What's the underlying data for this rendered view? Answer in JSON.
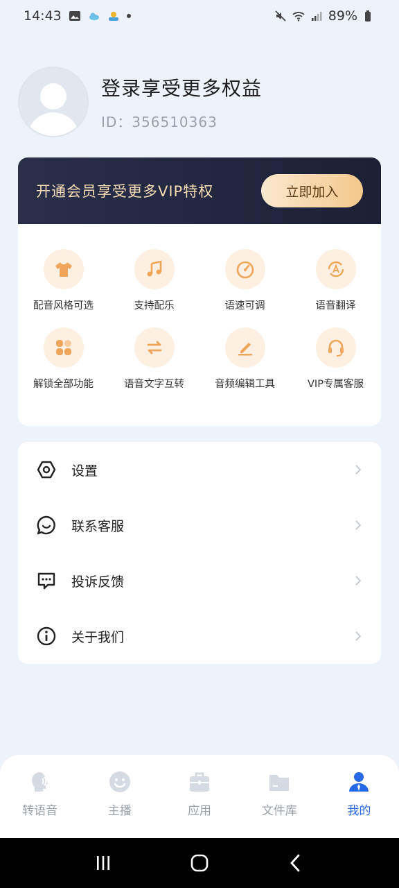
{
  "status_bar": {
    "time": "14:43",
    "battery": "89%"
  },
  "profile": {
    "login_title": "登录享受更多权益",
    "user_id": "ID：356510363"
  },
  "vip": {
    "banner_text": "开通会员享受更多VIP特权",
    "join_label": "立即加入",
    "features": [
      {
        "label": "配音风格可选",
        "icon": "tshirt-icon"
      },
      {
        "label": "支持配乐",
        "icon": "music-note-icon"
      },
      {
        "label": "语速可调",
        "icon": "speedometer-icon"
      },
      {
        "label": "语音翻译",
        "icon": "translate-icon"
      },
      {
        "label": "解锁全部功能",
        "icon": "grid-icon"
      },
      {
        "label": "语音文字互转",
        "icon": "swap-icon"
      },
      {
        "label": "音频编辑工具",
        "icon": "pencil-icon"
      },
      {
        "label": "VIP专属客服",
        "icon": "headset-icon"
      }
    ]
  },
  "menu": {
    "items": [
      {
        "label": "设置",
        "icon": "settings-hexagon-icon"
      },
      {
        "label": "联系客服",
        "icon": "chat-bubble-icon"
      },
      {
        "label": "投诉反馈",
        "icon": "feedback-icon"
      },
      {
        "label": "关于我们",
        "icon": "info-icon"
      }
    ]
  },
  "bottom_nav": {
    "items": [
      {
        "label": "转语音",
        "icon": "voice-head-icon"
      },
      {
        "label": "主播",
        "icon": "smiley-icon"
      },
      {
        "label": "应用",
        "icon": "briefcase-icon"
      },
      {
        "label": "文件库",
        "icon": "folder-icon"
      },
      {
        "label": "我的",
        "icon": "person-icon",
        "active": true
      }
    ]
  },
  "colors": {
    "accent": "#2569e8",
    "vip_gold": "#f3c88b",
    "feature_icon": "#f0a65a"
  }
}
